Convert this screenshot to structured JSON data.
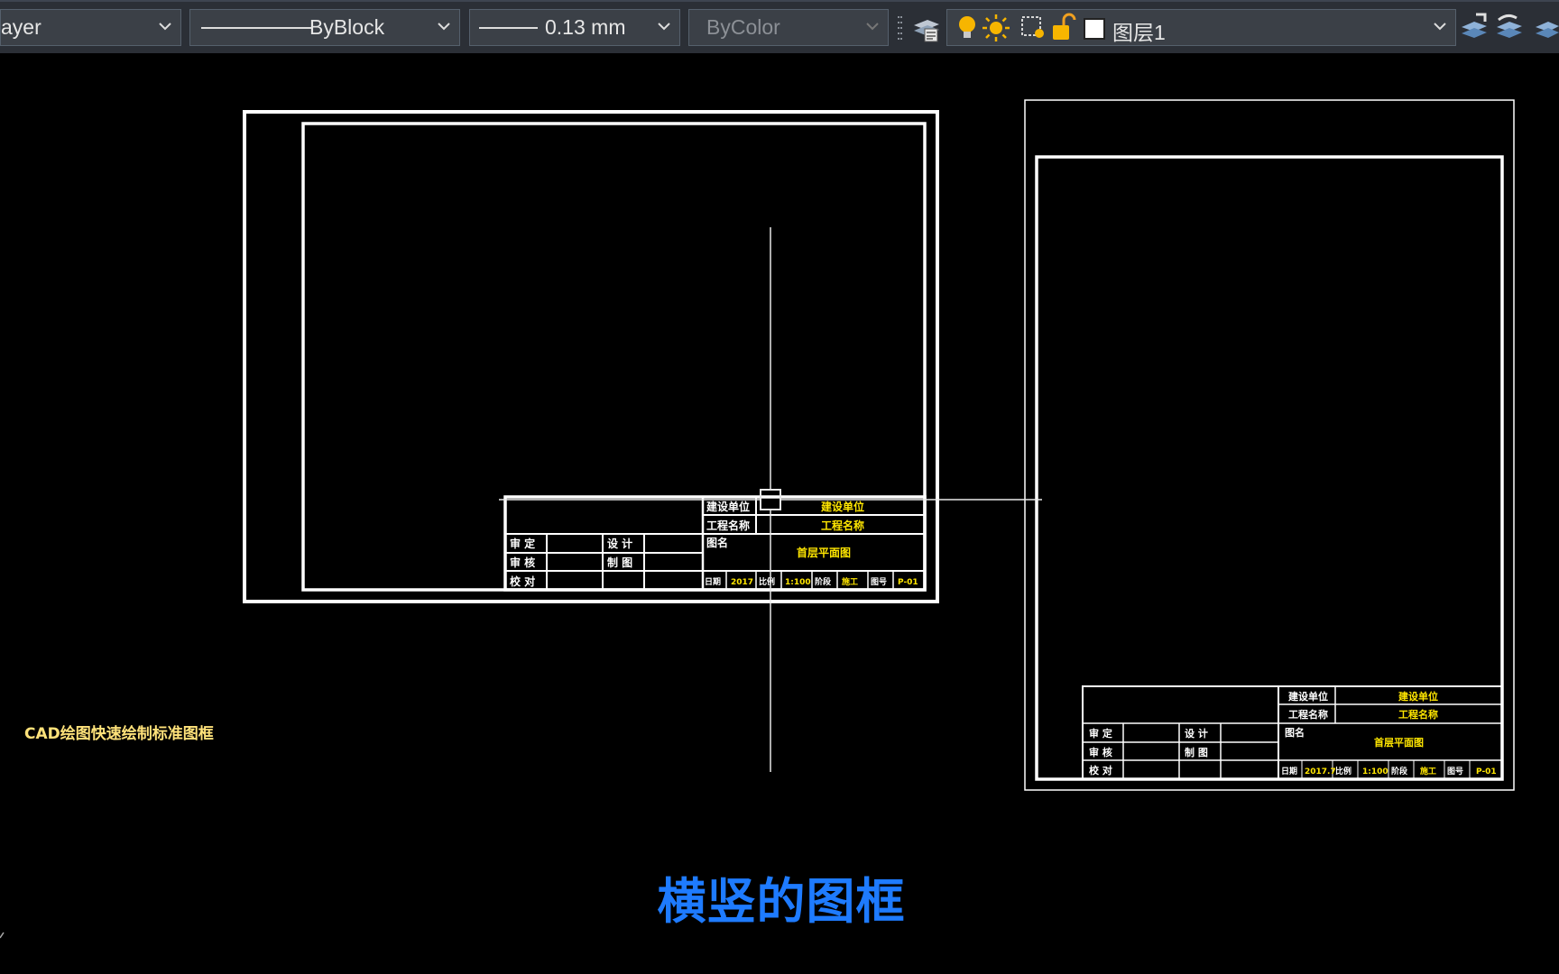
{
  "toolbar": {
    "layer_combo": "ayer",
    "linetype_combo": "ByBlock",
    "lineweight_combo": "0.13 mm",
    "plotstyle_combo": "ByColor",
    "layer_state_combo": "图层1"
  },
  "canvas": {
    "landscape_titleblock": {
      "row1_label": "建设单位",
      "row1_value": "建设单位",
      "row2_label": "工程名称",
      "row2_value": "工程名称",
      "drawing_name_label": "图名",
      "drawing_name_value": "首层平面图",
      "left_rows": [
        {
          "a": "审 定",
          "b": "设 计"
        },
        {
          "a": "审 核",
          "b": "制 图"
        },
        {
          "a": "校 对",
          "b": ""
        }
      ],
      "bottom_cells": [
        "日期",
        "2017",
        "比例",
        "1:100",
        "阶段",
        "施工",
        "图号",
        "P-01"
      ]
    },
    "portrait_titleblock": {
      "row1_label": "建设单位",
      "row1_value": "建设单位",
      "row2_label": "工程名称",
      "row2_value": "工程名称",
      "drawing_name_label": "图名",
      "drawing_name_value": "首层平面图",
      "left_rows": [
        {
          "a": "审 定",
          "b": "设 计"
        },
        {
          "a": "审 核",
          "b": "制 图"
        },
        {
          "a": "校 对",
          "b": ""
        }
      ],
      "bottom_cells": [
        "日期",
        "2017.7",
        "比例",
        "1:100",
        "阶段",
        "施工",
        "图号",
        "P-01"
      ]
    },
    "side_label": "CAD绘图快速绘制标准图框",
    "caption": "横竖的图框"
  },
  "colors": {
    "toolbar_bg": "#2b2f36",
    "canvas_bg": "#000000",
    "caption": "#1e7bff",
    "annotation_yellow": "#ffe600"
  }
}
